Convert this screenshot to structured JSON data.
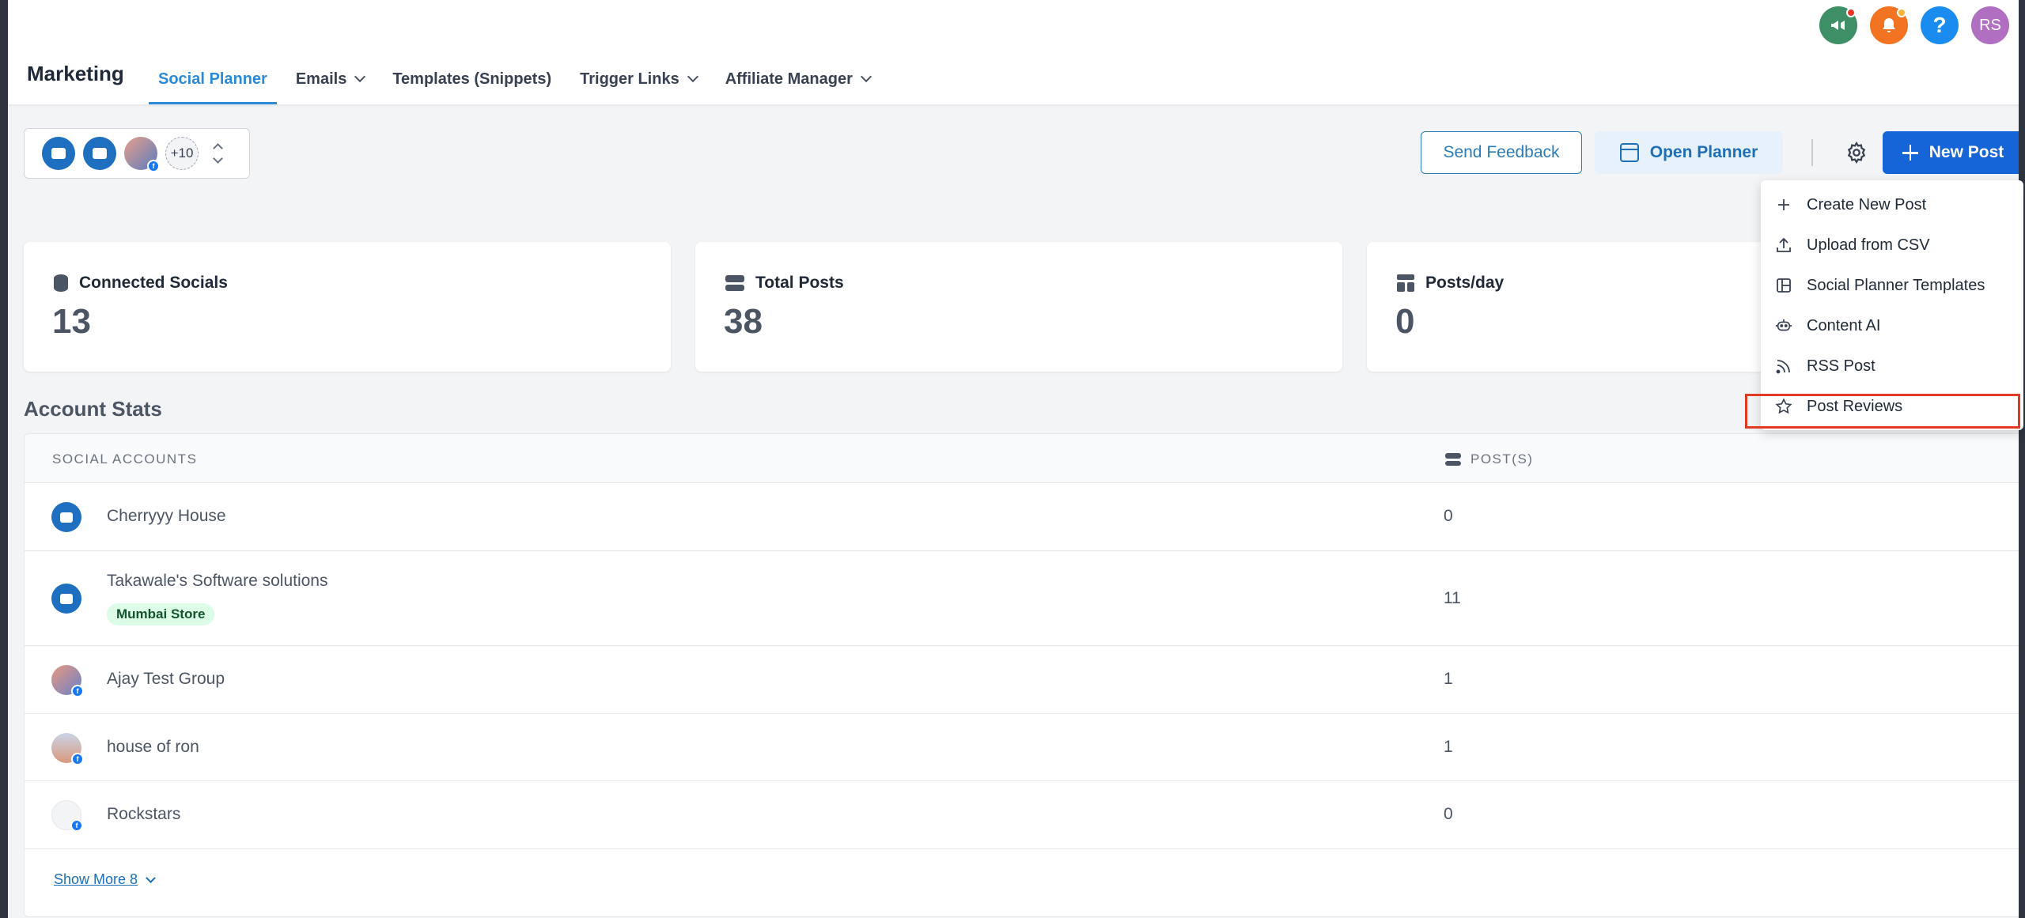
{
  "header": {
    "brand": "Marketing",
    "nav": [
      {
        "label": "Social Planner",
        "active": true
      },
      {
        "label": "Emails",
        "dropdown": true
      },
      {
        "label": "Templates (Snippets)"
      },
      {
        "label": "Trigger Links",
        "dropdown": true
      },
      {
        "label": "Affiliate Manager",
        "dropdown": true
      }
    ],
    "top_icons": [
      "megaphone-icon",
      "bell-icon",
      "help-icon"
    ],
    "user_initials": "RS"
  },
  "toolbar": {
    "account_more": "+10",
    "send_feedback": "Send Feedback",
    "open_planner": "Open Planner",
    "new_post": "New Post"
  },
  "stats": [
    {
      "label": "Connected Socials",
      "value": "13"
    },
    {
      "label": "Total Posts",
      "value": "38"
    },
    {
      "label": "Posts/day",
      "value": "0"
    }
  ],
  "account_stats": {
    "title": "Account Stats",
    "columns": [
      "SOCIAL ACCOUNTS",
      "POST(S)"
    ],
    "rows": [
      {
        "name": "Cherryyy House",
        "posts": "0"
      },
      {
        "name": "Takawale's Software solutions",
        "tag": "Mumbai Store",
        "posts": "11"
      },
      {
        "name": "Ajay Test Group",
        "posts": "1"
      },
      {
        "name": "house of ron",
        "posts": "1"
      },
      {
        "name": "Rockstars",
        "posts": "0"
      }
    ],
    "show_more": "Show More 8"
  },
  "new_post_menu": [
    {
      "label": "Create New Post",
      "icon": "plus-icon"
    },
    {
      "label": "Upload from CSV",
      "icon": "upload-icon"
    },
    {
      "label": "Social Planner Templates",
      "icon": "template-icon"
    },
    {
      "label": "Content AI",
      "icon": "robot-icon"
    },
    {
      "label": "RSS Post",
      "icon": "rss-icon"
    },
    {
      "label": "Post Reviews",
      "icon": "star-icon",
      "highlighted": true
    }
  ],
  "colors": {
    "primary": "#1565d8",
    "accent": "#2b8ad8",
    "highlight": "#e03a24"
  }
}
